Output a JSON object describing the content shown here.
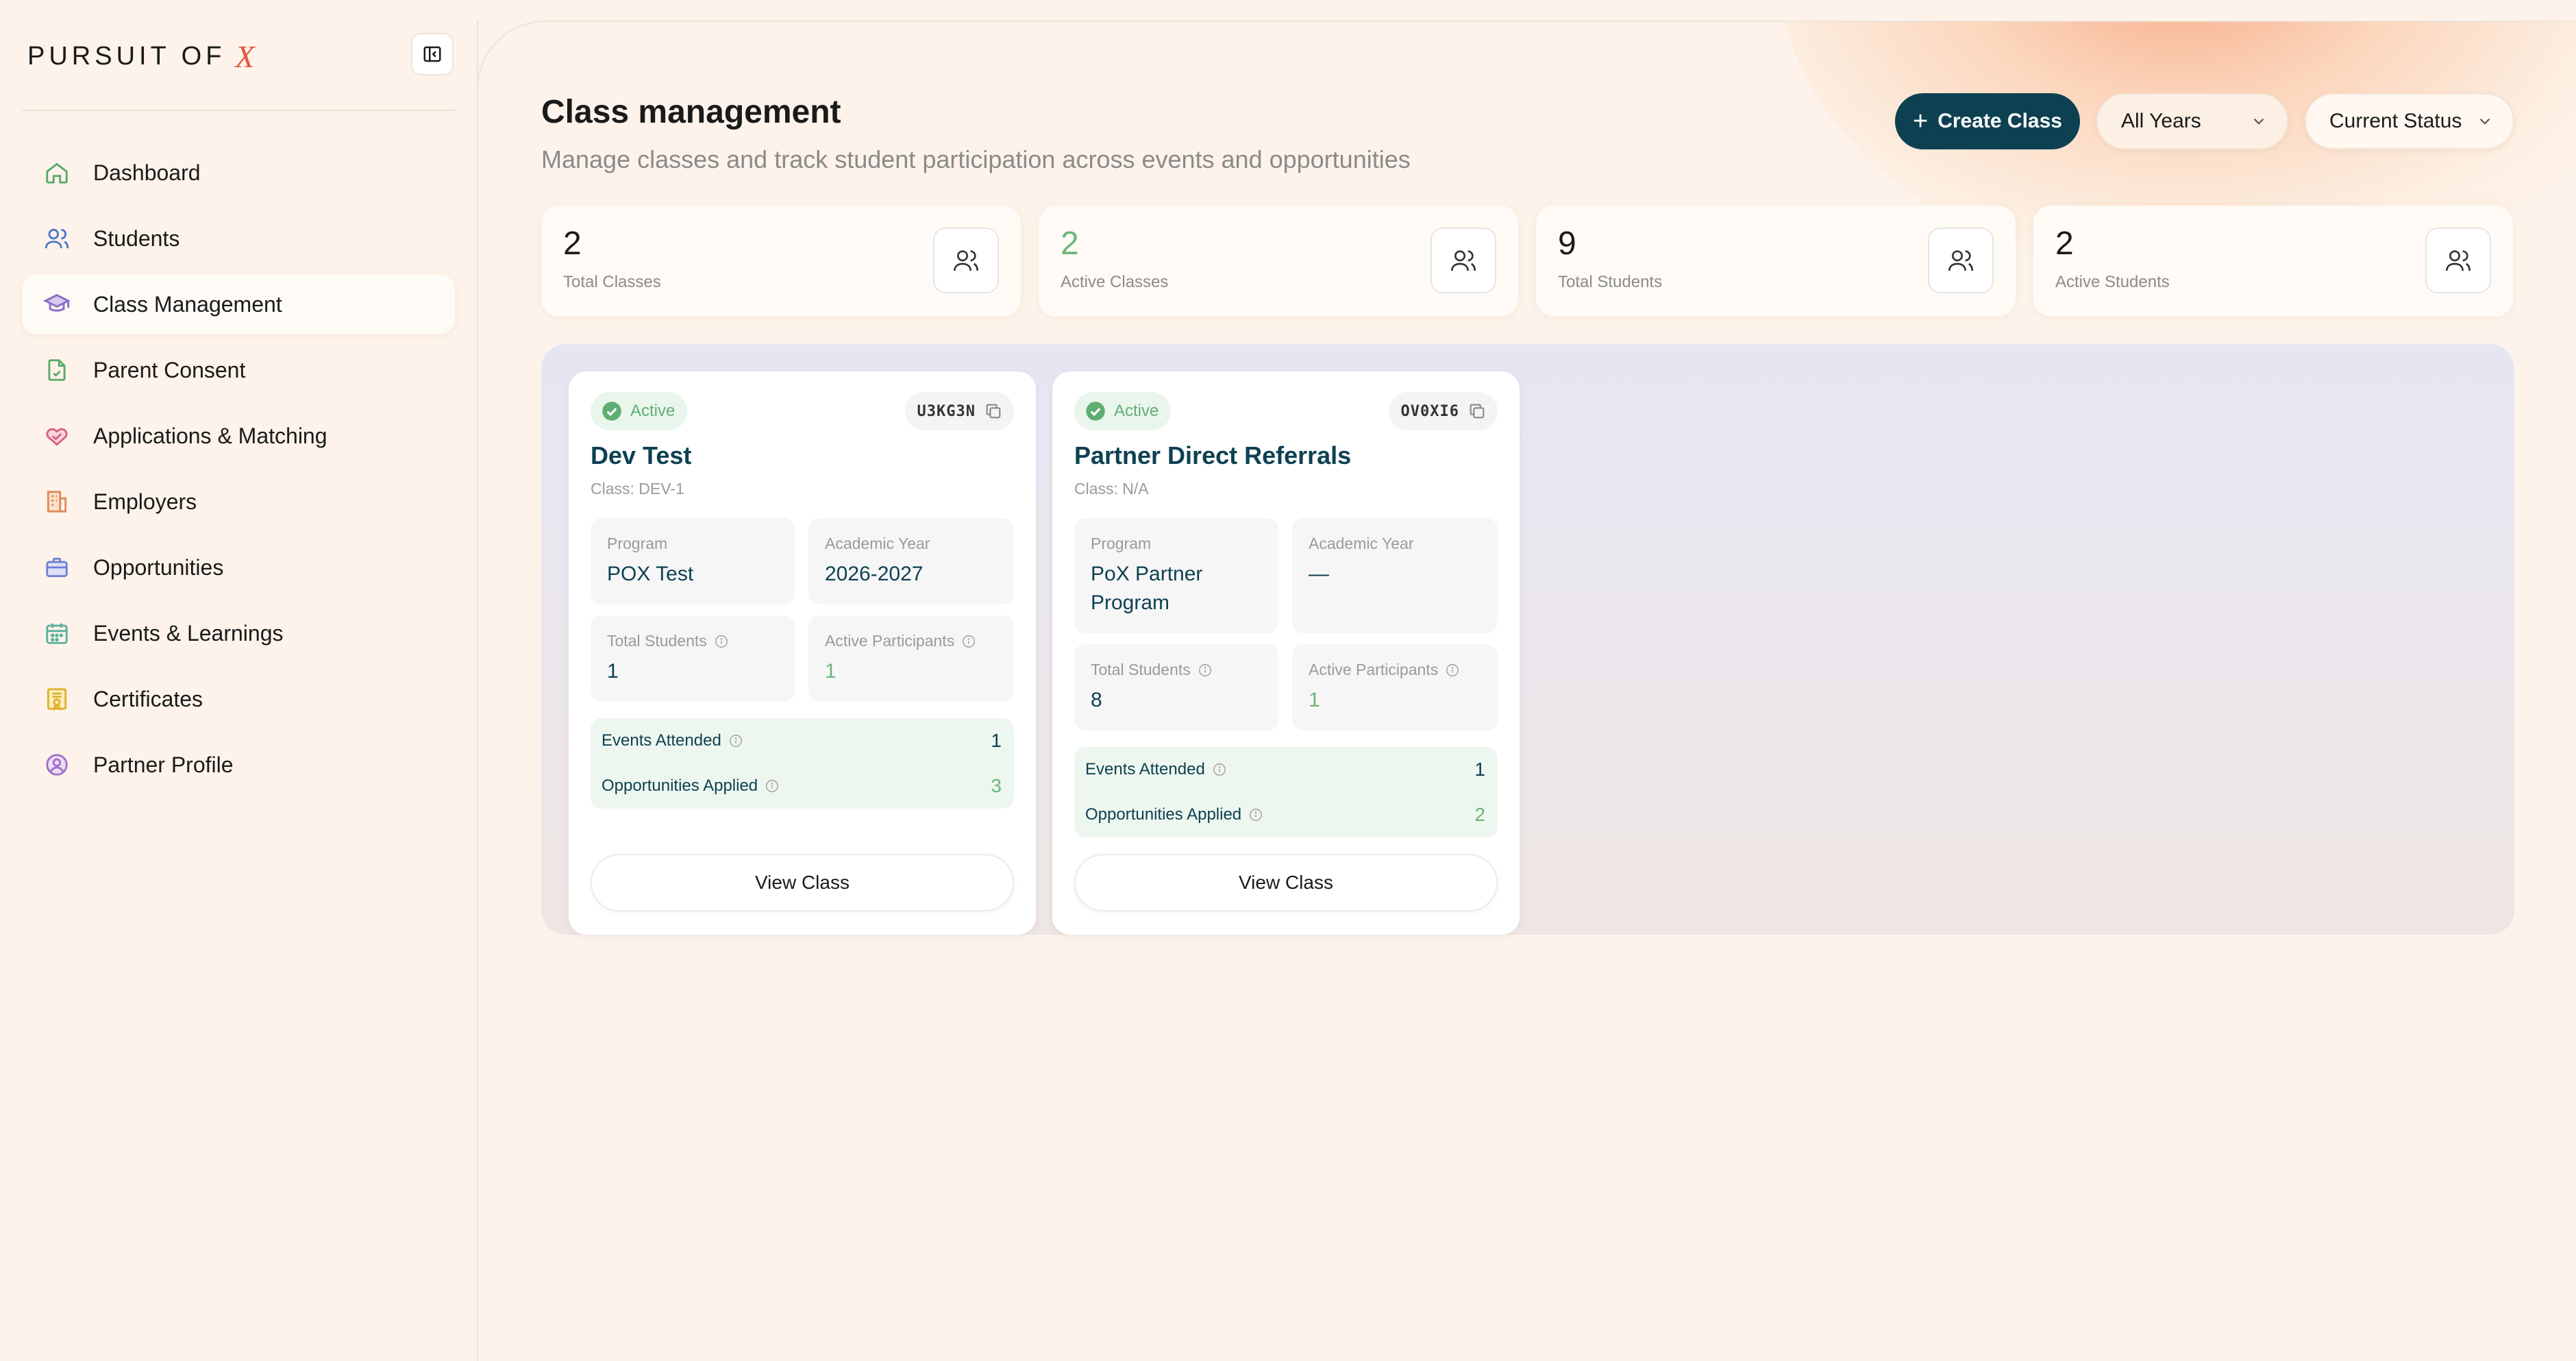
{
  "brand": {
    "text": "PURSUIT OF",
    "mark": "X"
  },
  "sidebar": {
    "items": [
      {
        "label": "Dashboard",
        "icon": "home-icon",
        "color": "#5aa86a"
      },
      {
        "label": "Students",
        "icon": "users-icon",
        "color": "#4a78c8"
      },
      {
        "label": "Class Management",
        "icon": "graduation-cap-icon",
        "color": "#8b6fc8",
        "active": true
      },
      {
        "label": "Parent Consent",
        "icon": "file-check-icon",
        "color": "#5aa86a"
      },
      {
        "label": "Applications & Matching",
        "icon": "handshake-icon",
        "color": "#d8607a"
      },
      {
        "label": "Employers",
        "icon": "building-icon",
        "color": "#e08a5a"
      },
      {
        "label": "Opportunities",
        "icon": "briefcase-icon",
        "color": "#6f7fd0"
      },
      {
        "label": "Events & Learnings",
        "icon": "calendar-icon",
        "color": "#5ab0a0"
      },
      {
        "label": "Certificates",
        "icon": "award-icon",
        "color": "#e0b030"
      },
      {
        "label": "Partner Profile",
        "icon": "user-circle-icon",
        "color": "#a070c8"
      }
    ]
  },
  "header": {
    "title": "Class management",
    "subtitle": "Manage classes and track student participation across events and opportunities",
    "create_label": "Create Class",
    "years_select": "All Years",
    "status_select": "Current Status"
  },
  "stats": [
    {
      "value": "2",
      "label": "Total Classes",
      "highlight": false
    },
    {
      "value": "2",
      "label": "Active Classes",
      "highlight": true
    },
    {
      "value": "9",
      "label": "Total Students",
      "highlight": false
    },
    {
      "value": "2",
      "label": "Active Students",
      "highlight": false
    }
  ],
  "classes": [
    {
      "status": "Active",
      "code": "U3KG3N",
      "title": "Dev Test",
      "class_label": "Class: DEV-1",
      "program_label": "Program",
      "program": "POX Test",
      "year_label": "Academic Year",
      "year": "2026-2027",
      "total_students_label": "Total Students",
      "total_students": "1",
      "active_participants_label": "Active Participants",
      "active_participants": "1",
      "events_attended_label": "Events Attended",
      "events_attended": "1",
      "opportunities_applied_label": "Opportunities Applied",
      "opportunities_applied": "3",
      "view_label": "View Class"
    },
    {
      "status": "Active",
      "code": "OV0XI6",
      "title": "Partner Direct Referrals",
      "class_label": "Class: N/A",
      "program_label": "Program",
      "program": "PoX Partner Program",
      "year_label": "Academic Year",
      "year": "—",
      "total_students_label": "Total Students",
      "total_students": "8",
      "active_participants_label": "Active Participants",
      "active_participants": "1",
      "events_attended_label": "Events Attended",
      "events_attended": "1",
      "opportunities_applied_label": "Opportunities Applied",
      "opportunities_applied": "2",
      "view_label": "View Class"
    }
  ]
}
